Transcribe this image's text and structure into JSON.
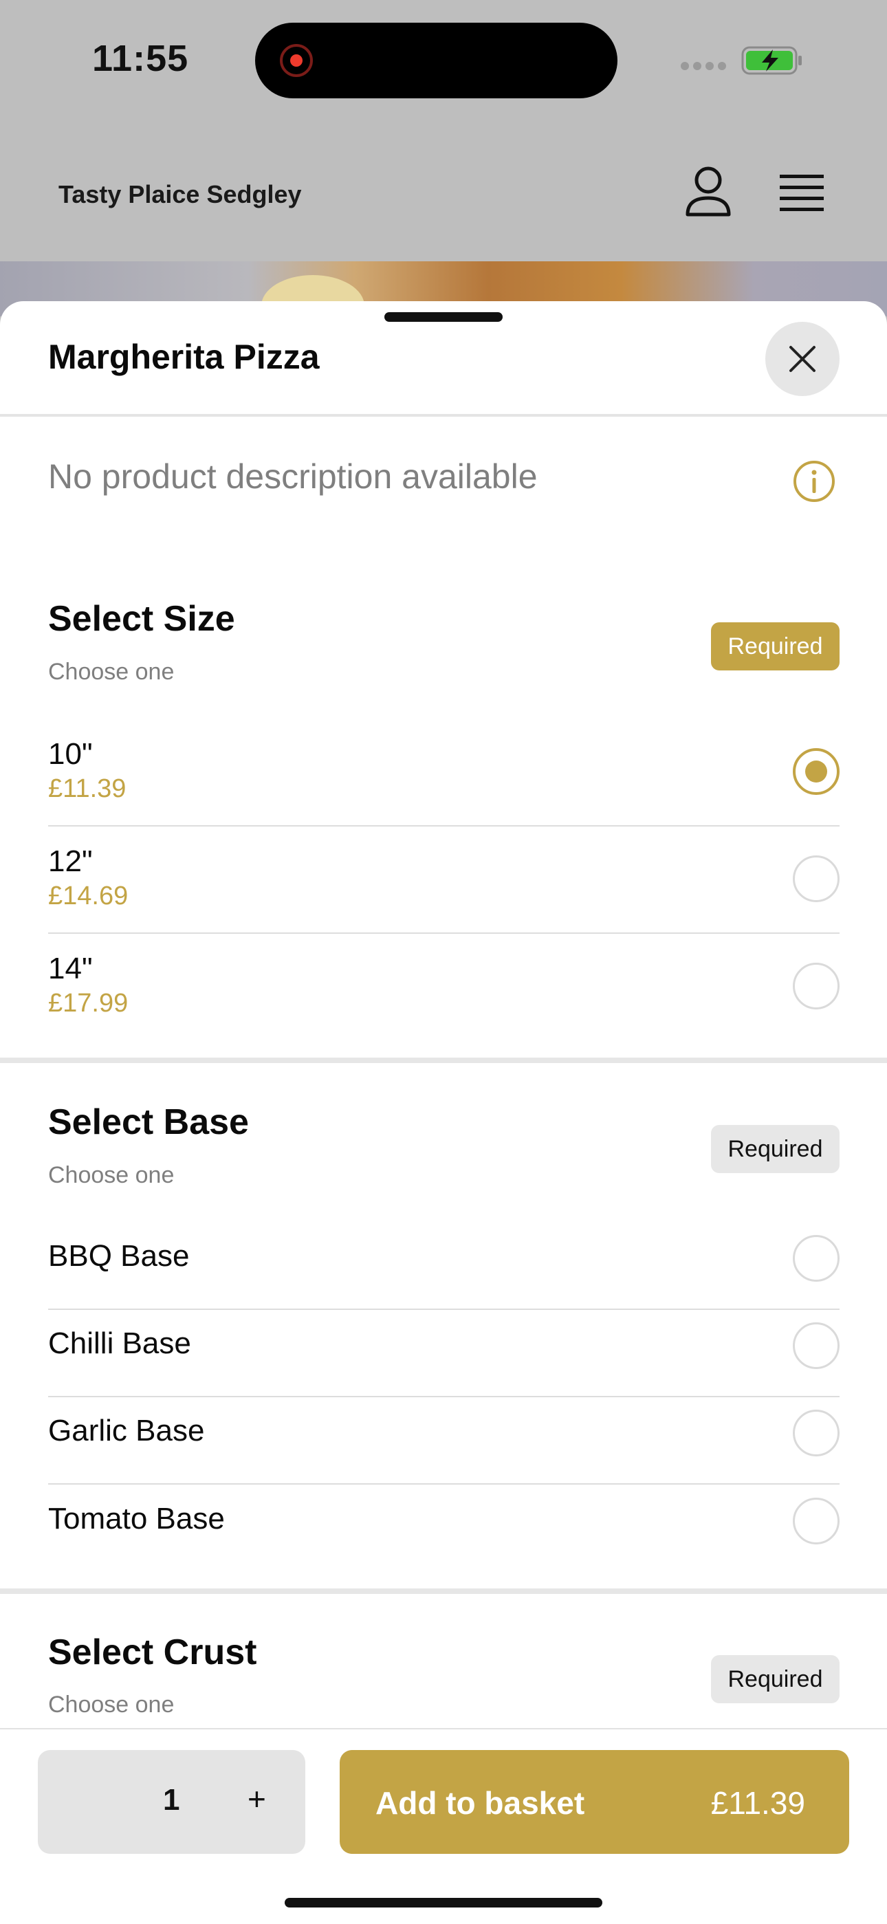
{
  "status_bar": {
    "time": "11:55"
  },
  "header": {
    "title": "Tasty Plaice Sedgley",
    "icons": [
      "user-icon",
      "menu-icon"
    ]
  },
  "product": {
    "title": "Margherita Pizza",
    "description": "No product description available"
  },
  "sections": {
    "size": {
      "title": "Select Size",
      "subtitle": "Choose one",
      "badge": "Required",
      "options": [
        {
          "name": "10\"",
          "price": "£11.39",
          "selected": true
        },
        {
          "name": "12\"",
          "price": "£14.69",
          "selected": false
        },
        {
          "name": "14\"",
          "price": "£17.99",
          "selected": false
        }
      ]
    },
    "base": {
      "title": "Select Base",
      "subtitle": "Choose one",
      "badge": "Required",
      "options": [
        {
          "name": "BBQ Base",
          "selected": false
        },
        {
          "name": "Chilli Base",
          "selected": false
        },
        {
          "name": "Garlic Base",
          "selected": false
        },
        {
          "name": "Tomato Base",
          "selected": false
        }
      ]
    },
    "crust": {
      "title": "Select Crust",
      "subtitle": "Choose one",
      "badge": "Required"
    }
  },
  "footer": {
    "quantity": "1",
    "plus": "+",
    "add_label": "Add to basket",
    "add_price": "£11.39"
  },
  "colors": {
    "accent": "#c3a445",
    "badge_grey": "#e7e7e7"
  }
}
